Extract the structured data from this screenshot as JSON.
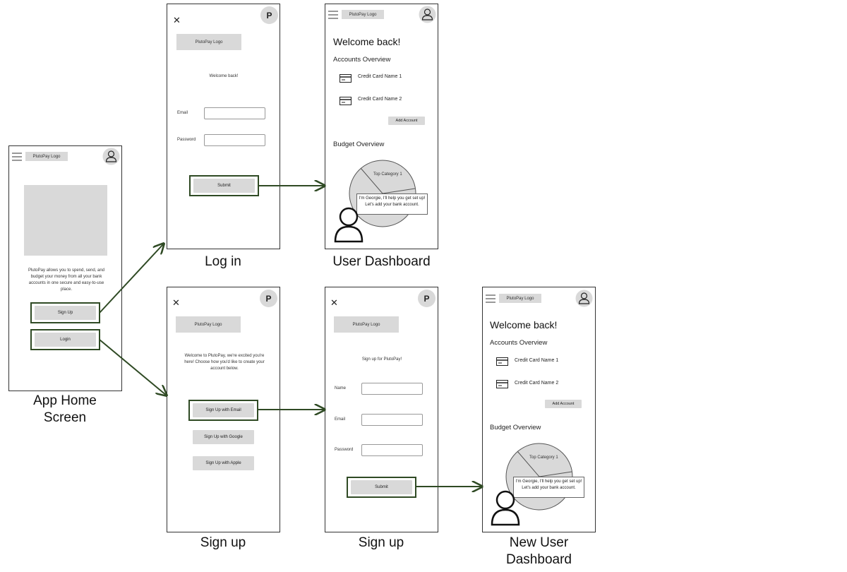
{
  "brand": {
    "logo_label": "PlutoPay Logo",
    "p_badge": "P"
  },
  "home": {
    "description": "PlutoPay allows you to spend, send, and budget your money from all your bank accounts in one secure and easy-to-use place.",
    "signup_button": "Sign Up",
    "login_button": "Login",
    "caption": "App Home Screen"
  },
  "login": {
    "welcome": "Welcome back!",
    "email_label": "Email",
    "password_label": "Password",
    "submit_button": "Submit",
    "caption": "Log in"
  },
  "dashboard": {
    "title": "Welcome back!",
    "accounts_heading": "Accounts Overview",
    "cards": [
      "Credit Card Name 1",
      "Credit Card Name 2"
    ],
    "add_account_button": "Add Account",
    "budget_heading": "Budget Overview",
    "top_category": "Top Category 1",
    "assistant_message": "I'm Georgie, I'll help you get set up! Let's add your bank account.",
    "caption": "User Dashboard",
    "new_caption": "New User Dashboard"
  },
  "signup_options": {
    "intro": "Welcome to PlutoPay, we're excited you're here! Choose how you'd like to create your account below.",
    "email_button": "Sign Up with Email",
    "google_button": "Sign Up with Google",
    "apple_button": "Sign Up with Apple",
    "caption": "Sign up"
  },
  "signup_form": {
    "heading": "Sign up for PlutoPay!",
    "name_label": "Name",
    "email_label": "Email",
    "password_label": "Password",
    "submit_button": "Submit",
    "caption": "Sign up"
  },
  "colors": {
    "highlight": "#2f4a24",
    "placeholder": "#d9d9d9"
  }
}
